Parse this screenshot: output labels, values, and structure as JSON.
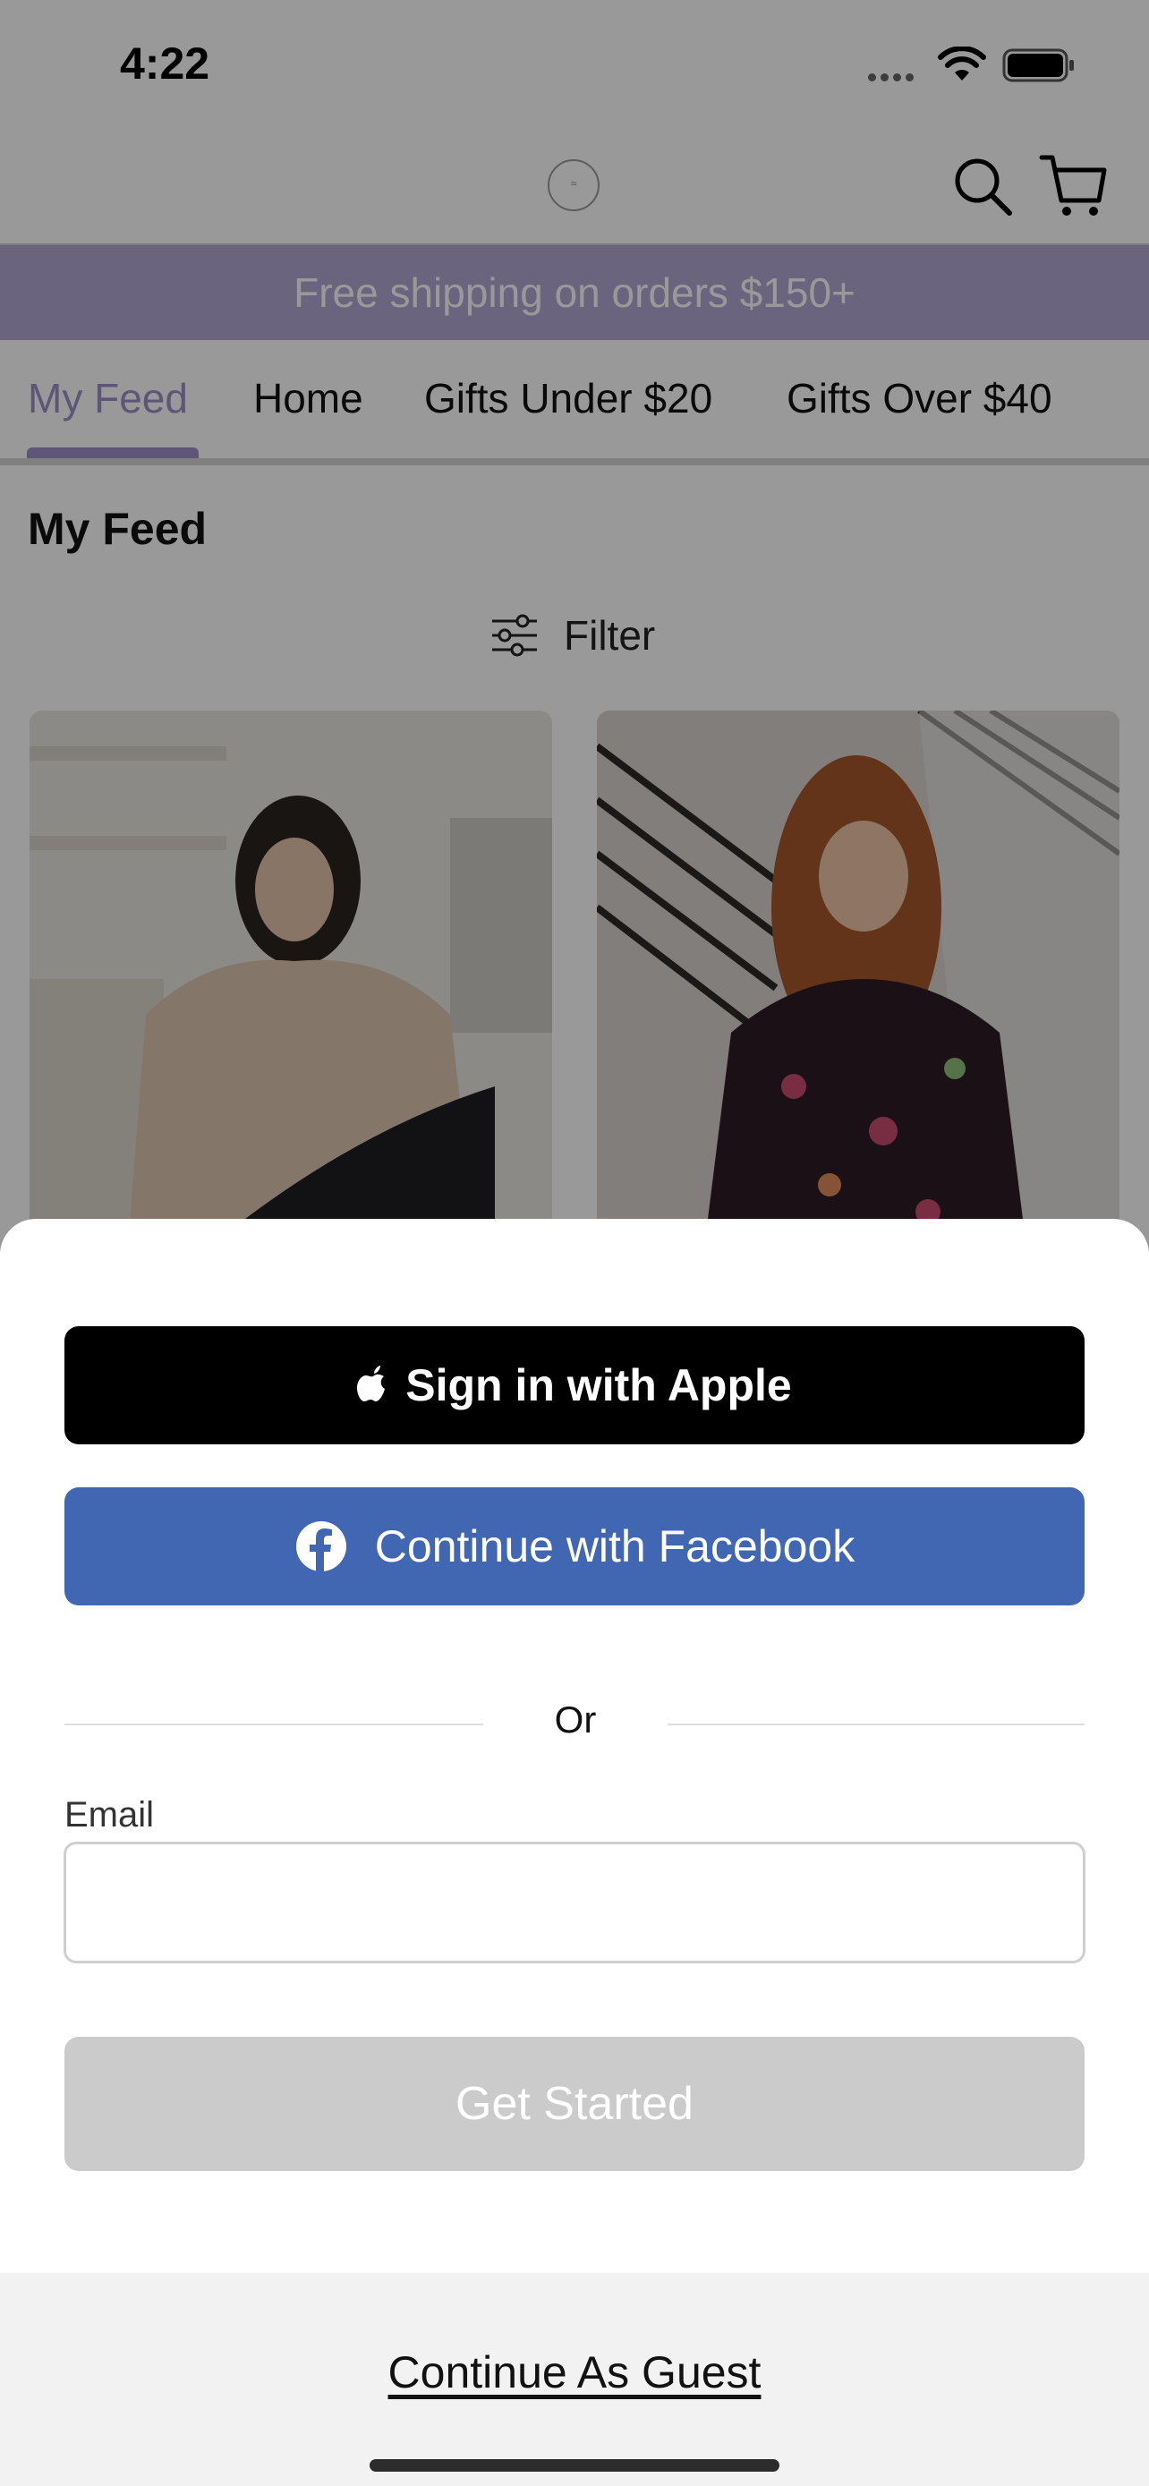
{
  "status_bar": {
    "time": "4:22"
  },
  "header": {
    "logo_icon": "brand-logo-icon",
    "search_icon": "search-icon",
    "cart_icon": "cart-icon"
  },
  "promo_banner": {
    "text": "Free shipping on orders $150+"
  },
  "nav": {
    "tabs": [
      {
        "label": "My Feed",
        "active": true
      },
      {
        "label": "Home",
        "active": false
      },
      {
        "label": "Gifts Under $20",
        "active": false
      },
      {
        "label": "Gifts Over $40",
        "active": false
      }
    ]
  },
  "feed": {
    "title": "My Feed",
    "filter_label": "Filter"
  },
  "colors": {
    "accent": "#9d90c6",
    "banner": "#b3a7d4",
    "apple_button": "#000000",
    "facebook_button": "#4267b2",
    "disabled_button": "#cbcbcb"
  },
  "login_sheet": {
    "apple_button": "Sign in with Apple",
    "facebook_button": "Continue with Facebook",
    "divider": "Or",
    "email_label": "Email",
    "email_value": "",
    "email_placeholder": "",
    "get_started_button": "Get Started",
    "guest_link": "Continue As Guest"
  }
}
